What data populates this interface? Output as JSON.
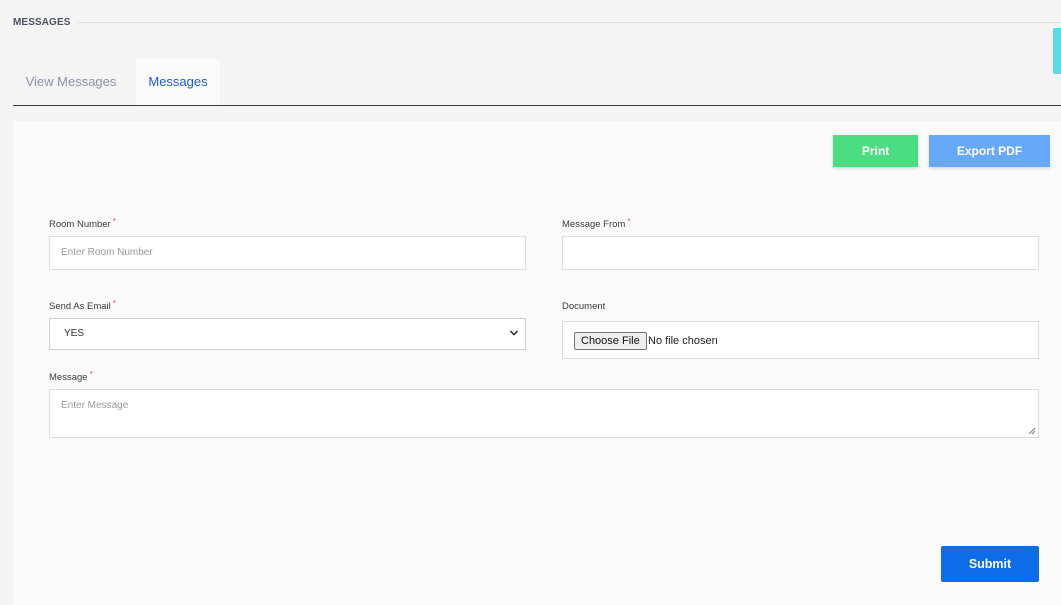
{
  "section": {
    "title": "MESSAGES"
  },
  "tabs": [
    {
      "label": "View Messages",
      "active": false
    },
    {
      "label": "Messages",
      "active": true
    }
  ],
  "toolbar": {
    "print_label": "Print",
    "export_label": "Export PDF"
  },
  "form": {
    "room_number": {
      "label": "Room Number",
      "required_mark": "*",
      "placeholder": "Enter Room Number",
      "value": ""
    },
    "message_from": {
      "label": "Message From",
      "required_mark": "*",
      "value": ""
    },
    "send_as_email": {
      "label": "Send As Email",
      "required_mark": "*",
      "selected": "YES"
    },
    "document": {
      "label": "Document",
      "button_label": "Choose File",
      "status": "No file chosen"
    },
    "message": {
      "label": "Message",
      "required_mark": "*",
      "placeholder": "Enter Message"
    },
    "submit_label": "Submit"
  },
  "colors": {
    "accent": "#1c5fc8",
    "print": "#4cdc82",
    "export": "#68a8f8",
    "submit": "#0d6de8",
    "required": "#e24b4b",
    "side_accent": "#5ed9e6"
  }
}
